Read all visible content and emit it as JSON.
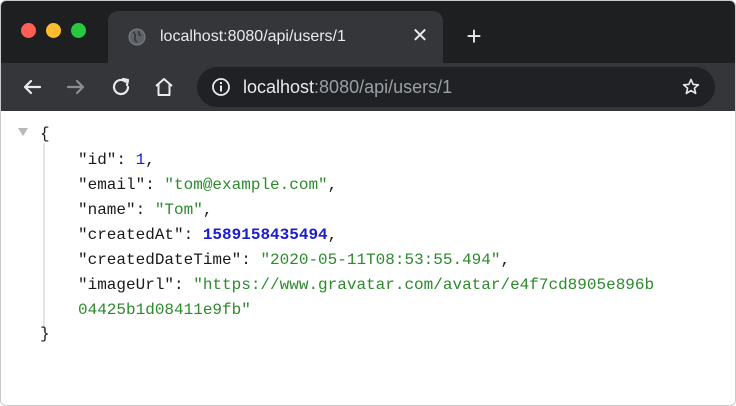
{
  "window": {
    "traffic_lights": {
      "close": "#ff5f56",
      "minimize": "#ffbd2e",
      "maximize": "#27c93f"
    }
  },
  "tab": {
    "title": "localhost:8080/api/users/1",
    "icon": "globe-icon",
    "close_glyph": "✕"
  },
  "new_tab_glyph": "+",
  "toolbar": {
    "back_icon": "arrow-left-icon",
    "forward_icon": "arrow-right-icon",
    "reload_icon": "reload-icon",
    "home_icon": "home-icon",
    "address": {
      "host": "localhost",
      "rest": ":8080/api/users/1"
    },
    "bookmark_icon": "star-icon"
  },
  "json_view": {
    "open_brace": "{",
    "close_brace": "}",
    "fields": [
      {
        "key": "\"id\"",
        "value": "1",
        "type": "number"
      },
      {
        "key": "\"email\"",
        "value": "\"tom@example.com\"",
        "type": "string"
      },
      {
        "key": "\"name\"",
        "value": "\"Tom\"",
        "type": "string"
      },
      {
        "key": "\"createdAt\"",
        "value": "1589158435494",
        "type": "number"
      },
      {
        "key": "\"createdDateTime\"",
        "value": "\"2020-05-11T08:53:55.494\"",
        "type": "string"
      },
      {
        "key": "\"imageUrl\"",
        "value_line1": "\"https://www.gravatar.com/avatar/e4f7cd8905e896b",
        "value_line2": "04425b1d08411e9fb\"",
        "type": "string"
      }
    ],
    "colors": {
      "string": "#2c8a2c",
      "number": "#1c1ccf",
      "key": "#1a1a1a"
    }
  }
}
